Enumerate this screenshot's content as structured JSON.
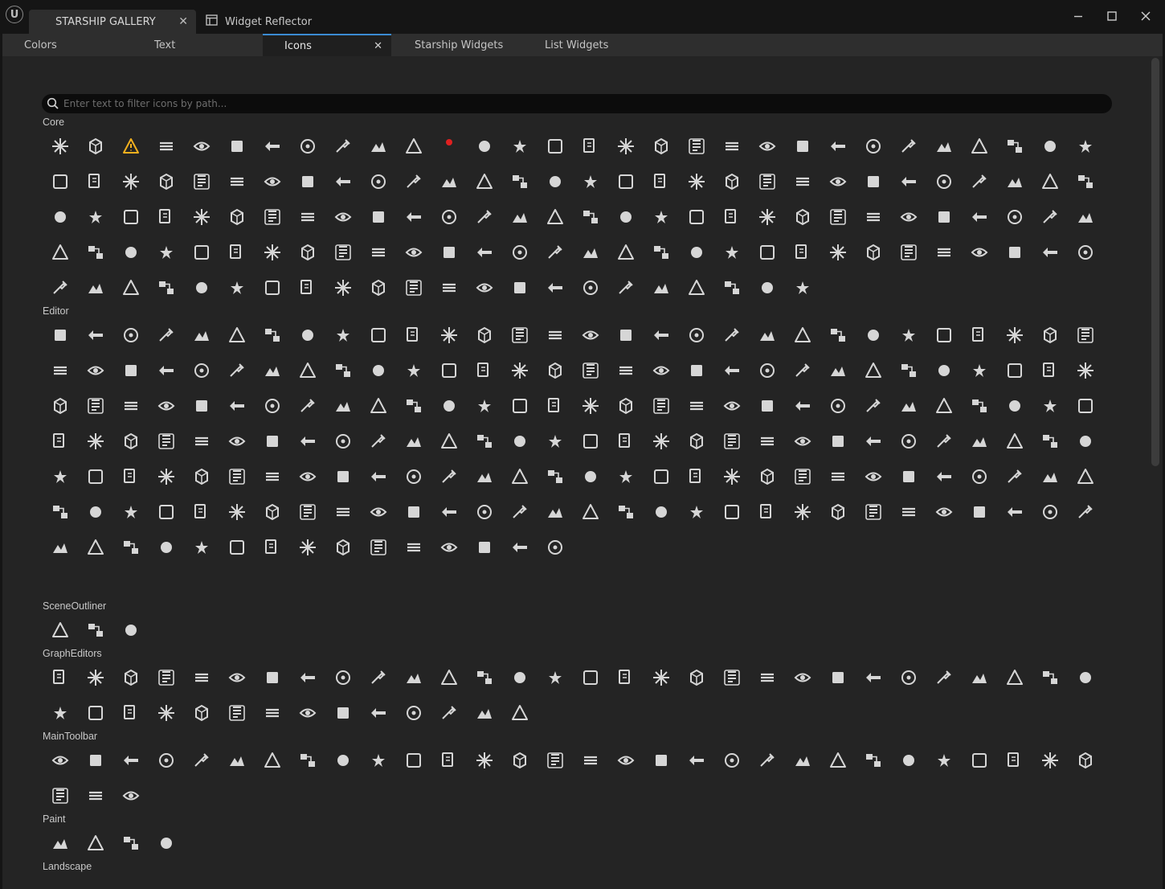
{
  "window": {
    "document_tabs": [
      {
        "label": "STARSHIP GALLERY",
        "active": true,
        "closable": true
      },
      {
        "label": "Widget Reflector",
        "active": false,
        "closable": false
      }
    ],
    "controls": [
      "minimize-icon",
      "maximize-icon",
      "close-icon"
    ]
  },
  "subtabs": [
    {
      "label": "Colors"
    },
    {
      "label": "Text"
    },
    {
      "label": "Icons",
      "active": true,
      "closable": true
    },
    {
      "label": "Starship Widgets"
    },
    {
      "label": "List Widgets"
    }
  ],
  "search": {
    "placeholder": "Enter text to filter icons by path...",
    "value": ""
  },
  "colors": {
    "accent": "#3b8bd3",
    "warning": "#f2b01e",
    "recording": "#e02020",
    "icon": "#d6d6d6"
  },
  "sections": [
    {
      "name": "Core",
      "icon_count": 142,
      "icons": [
        "atom-icon",
        "error-icon",
        "warning-icon",
        "warning-outline-icon",
        "warning-outline-icon",
        "save-checked-icon",
        "arrow-down-icon",
        "arrow-left-icon",
        "arrow-right-icon",
        "arrow-up-icon",
        "unplug-icon",
        "record-dot-icon",
        "hierarchy-icon",
        "box-icon",
        "dot-icon",
        "caret-down-icon",
        "caret-right-icon",
        "check-circle-outline-icon",
        "check-circle-icon",
        "check-icon",
        "chevron-down-icon",
        "chevron-left-icon",
        "chevron-right-icon",
        "chevron-up-icon",
        "circle-arrow-down-icon",
        "circle-arrow-left-icon",
        "circle-arrow-right-icon",
        "circle-arrow-up-icon",
        "circle-x-icon",
        "x-small-icon"
      ]
    },
    {
      "name": "Editor",
      "icon_count": 195,
      "icons": [
        "add-actor-icon",
        "wrench-icon",
        "align-icon",
        "layers-icon",
        "running-icon",
        "ramp-icon",
        "refresh-icon",
        "search-doc-icon",
        "sunrise-icon",
        "shapes-icon",
        "nodes-icon"
      ]
    },
    {
      "name": "SceneOutliner",
      "icon_count": 3,
      "icons": [
        "move-arrows-icon",
        "target-icon",
        "sliders-icon"
      ]
    },
    {
      "name": "GraphEditors",
      "icon_count": 44,
      "icons": [
        "align-bottom-icon",
        "align-left-icon",
        "align-center-icon",
        "align-right-icon",
        "align-top-icon"
      ]
    },
    {
      "name": "MainToolbar",
      "icon_count": 33,
      "icons": [
        "cut-icon",
        "branch-icon",
        "frame-icon",
        "clapper-icon",
        "grid-icon"
      ]
    },
    {
      "name": "Paint",
      "icon_count": 4,
      "icons": [
        "swap-icon",
        "fill-icon",
        "texture-icon",
        "drops-icon"
      ]
    },
    {
      "name": "Landscape",
      "icon_count": 0,
      "icons": []
    }
  ]
}
